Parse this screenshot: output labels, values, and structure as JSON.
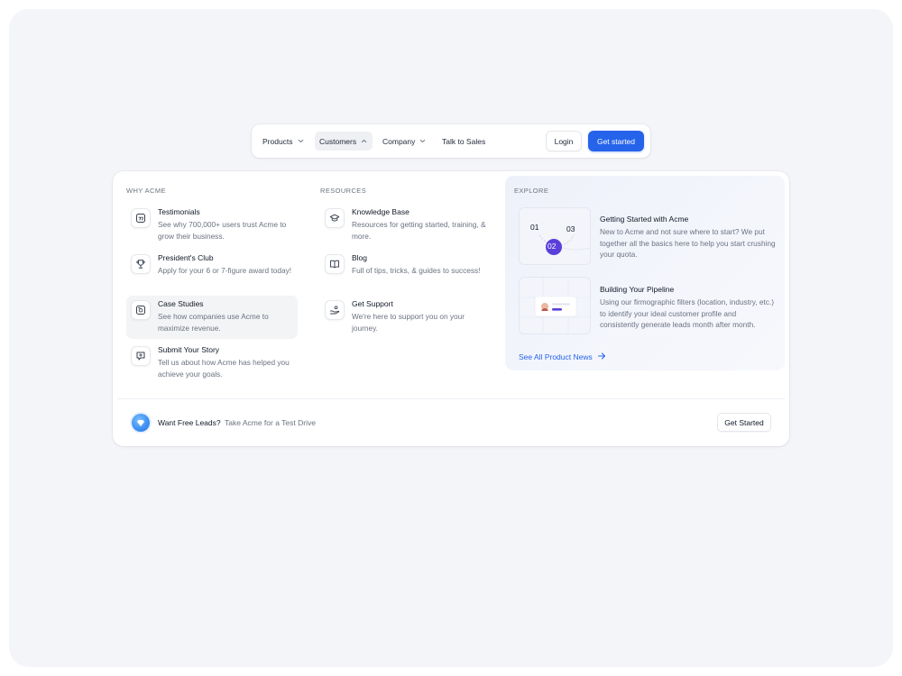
{
  "nav": {
    "items": [
      {
        "label": "Products",
        "has_chevron": true,
        "active": false
      },
      {
        "label": "Customers",
        "has_chevron": true,
        "active": true
      },
      {
        "label": "Company",
        "has_chevron": true,
        "active": false
      },
      {
        "label": "Talk to Sales",
        "has_chevron": false,
        "active": false
      }
    ],
    "login_label": "Login",
    "get_started_label": "Get started"
  },
  "why_acme": {
    "title": "WHY ACME",
    "items": [
      {
        "icon": "quote-icon",
        "title": "Testimonials",
        "desc": "See why 700,000+ users trust Acme to grow their business."
      },
      {
        "icon": "trophy-icon",
        "title": "President's Club",
        "desc": "Apply for your 6 or 7-figure award today!"
      },
      {
        "icon": "case-study-icon",
        "title": "Case Studies",
        "desc": "See how companies use Acme to maximize revenue."
      },
      {
        "icon": "message-plus-icon",
        "title": "Submit Your Story",
        "desc": "Tell us about how Acme has helped you achieve your goals."
      }
    ]
  },
  "resources": {
    "title": "RESOURCES",
    "items": [
      {
        "icon": "graduation-cap-icon",
        "title": "Knowledge Base",
        "desc": "Resources for getting started, training, & more."
      },
      {
        "icon": "book-icon",
        "title": "Blog",
        "desc": "Full of tips, tricks, & guides to success!"
      },
      {
        "icon": "support-hand-icon",
        "title": "Get Support",
        "desc": "We're here to support you on your journey."
      }
    ]
  },
  "explore": {
    "title": "EXPLORE",
    "cards": [
      {
        "title": "Getting Started with Acme",
        "desc": "New to Acme and not sure where to start? We put together all the basics here to help you start crushing your quota.",
        "steps": [
          "01",
          "02",
          "03"
        ]
      },
      {
        "title": "Building Your Pipeline",
        "desc": "Using our firmographic filters (location, industry, etc.) to identify your ideal customer profile and consistently generate leads month after month."
      }
    ],
    "see_all_label": "See All Product News"
  },
  "footer": {
    "label": "Want Free Leads?",
    "sub": "Take Acme for a Test Drive",
    "button_label": "Get Started"
  },
  "colors": {
    "accent": "#2563eb",
    "step_active": "#5b3fd9",
    "background": "#f4f5f8"
  }
}
